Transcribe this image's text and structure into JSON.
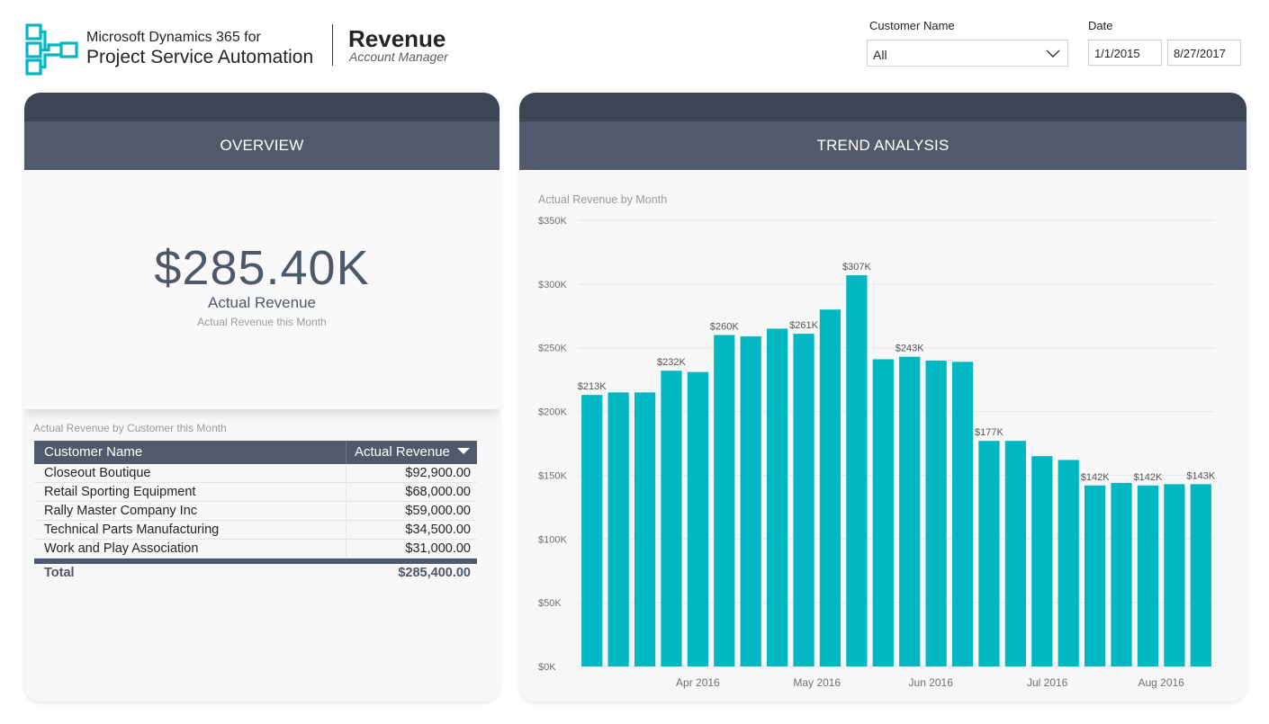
{
  "header": {
    "brand_line1": "Microsoft Dynamics 365 for",
    "brand_line2": "Project Service Automation",
    "title": "Revenue",
    "subtitle": "Account Manager",
    "logo_icon": "psa-logo-icon"
  },
  "filters": {
    "customer_label": "Customer Name",
    "customer_value": "All",
    "date_label": "Date",
    "date_start": "1/1/2015",
    "date_end": "8/27/2017"
  },
  "overview": {
    "heading": "OVERVIEW",
    "kpi_value": "$285.40K",
    "kpi_label": "Actual Revenue",
    "kpi_sub": "Actual Revenue this Month",
    "table_title": "Actual Revenue by Customer this Month",
    "columns": [
      "Customer Name",
      "Actual Revenue"
    ],
    "rows": [
      {
        "name": "Closeout Boutique",
        "value": "$92,900.00"
      },
      {
        "name": "Retail Sporting Equipment",
        "value": "$68,000.00"
      },
      {
        "name": "Rally Master Company Inc",
        "value": "$59,000.00"
      },
      {
        "name": "Technical Parts Manufacturing",
        "value": "$34,500.00"
      },
      {
        "name": "Work and Play Association",
        "value": "$31,000.00"
      }
    ],
    "total_label": "Total",
    "total_value": "$285,400.00"
  },
  "trend": {
    "heading": "TREND ANALYSIS",
    "chart_title": "Actual Revenue by Month"
  },
  "colors": {
    "bar": "#01b8c2",
    "header_dark": "#3b4554",
    "header": "#505a6a",
    "kpi_text": "#4d5869"
  },
  "chart_data": {
    "type": "bar",
    "title": "Actual Revenue by Month",
    "values": [
      213,
      215,
      215,
      232,
      231,
      260,
      259,
      265,
      261,
      280,
      307,
      241,
      243,
      240,
      239,
      177,
      177,
      165,
      162,
      142,
      144,
      142,
      143,
      143
    ],
    "data_labels": [
      {
        "index": 0,
        "text": "$213K"
      },
      {
        "index": 3,
        "text": "$232K"
      },
      {
        "index": 5,
        "text": "$260K"
      },
      {
        "index": 8,
        "text": "$261K"
      },
      {
        "index": 10,
        "text": "$307K"
      },
      {
        "index": 12,
        "text": "$243K"
      },
      {
        "index": 15,
        "text": "$177K"
      },
      {
        "index": 19,
        "text": "$142K"
      },
      {
        "index": 21,
        "text": "$142K"
      },
      {
        "index": 23,
        "text": "$143K"
      }
    ],
    "x_ticks": [
      {
        "index": 4,
        "label": "Apr 2016"
      },
      {
        "index": 8.5,
        "label": "May 2016"
      },
      {
        "index": 12.8,
        "label": "Jun 2016"
      },
      {
        "index": 17.2,
        "label": "Jul 2016"
      },
      {
        "index": 21.5,
        "label": "Aug 2016"
      }
    ],
    "y_ticks": [
      "$0K",
      "$50K",
      "$100K",
      "$150K",
      "$200K",
      "$250K",
      "$300K",
      "$350K"
    ],
    "ylim": [
      0,
      350
    ],
    "units": "K",
    "grid": true
  }
}
